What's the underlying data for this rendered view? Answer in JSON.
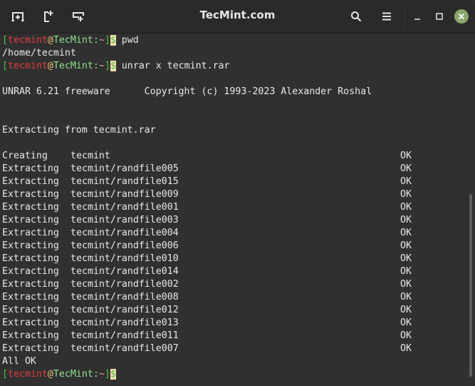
{
  "window": {
    "title": "TecMint.com",
    "header_buttons_left": [
      {
        "name": "new-tab-icon",
        "tooltip": ""
      },
      {
        "name": "new-window-icon",
        "tooltip": ""
      },
      {
        "name": "split-icon",
        "tooltip": ""
      }
    ],
    "header_buttons_right": [
      "search-icon",
      "menu-icon",
      "minimize-icon",
      "maximize-icon",
      "close-icon"
    ]
  },
  "prompt": {
    "open_bracket": "[",
    "user": "tecmint",
    "at": "@",
    "host": "TecMint",
    "colon": ":",
    "path": "~",
    "close_bracket": "]",
    "dollar": "$"
  },
  "session": {
    "cmd1": " pwd",
    "out1": "/home/tecmint",
    "cmd2": " unrar x tecmint.rar",
    "banner": "UNRAR 6.21 freeware      Copyright (c) 1993-2023 Alexander Roshal",
    "extracting_from": "Extracting from tecmint.rar",
    "entries": [
      {
        "action": "Creating",
        "path": "tecmint",
        "status": "OK"
      },
      {
        "action": "Extracting",
        "path": "tecmint/randfile005",
        "status": "OK"
      },
      {
        "action": "Extracting",
        "path": "tecmint/randfile015",
        "status": "OK"
      },
      {
        "action": "Extracting",
        "path": "tecmint/randfile009",
        "status": "OK"
      },
      {
        "action": "Extracting",
        "path": "tecmint/randfile001",
        "status": "OK"
      },
      {
        "action": "Extracting",
        "path": "tecmint/randfile003",
        "status": "OK"
      },
      {
        "action": "Extracting",
        "path": "tecmint/randfile004",
        "status": "OK"
      },
      {
        "action": "Extracting",
        "path": "tecmint/randfile006",
        "status": "OK"
      },
      {
        "action": "Extracting",
        "path": "tecmint/randfile010",
        "status": "OK"
      },
      {
        "action": "Extracting",
        "path": "tecmint/randfile014",
        "status": "OK"
      },
      {
        "action": "Extracting",
        "path": "tecmint/randfile002",
        "status": "OK"
      },
      {
        "action": "Extracting",
        "path": "tecmint/randfile008",
        "status": "OK"
      },
      {
        "action": "Extracting",
        "path": "tecmint/randfile012",
        "status": "OK"
      },
      {
        "action": "Extracting",
        "path": "tecmint/randfile013",
        "status": "OK"
      },
      {
        "action": "Extracting",
        "path": "tecmint/randfile011",
        "status": "OK"
      },
      {
        "action": "Extracting",
        "path": "tecmint/randfile007",
        "status": "OK"
      }
    ],
    "summary": "All OK"
  }
}
